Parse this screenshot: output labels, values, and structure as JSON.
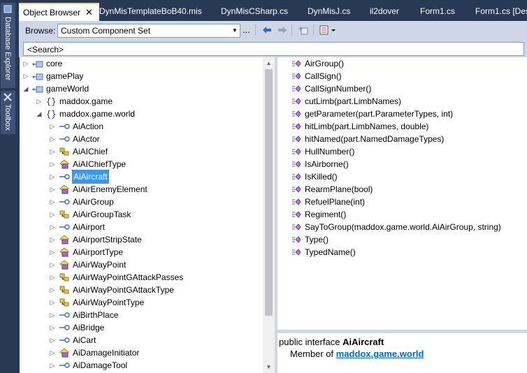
{
  "side_tabs": [
    "Database Explorer",
    "Toolbox"
  ],
  "doc_tabs": [
    {
      "label": "Object Browser",
      "active": true
    },
    {
      "label": "DynMisTemplateBoB40.mis"
    },
    {
      "label": "DynMisCSharp.cs"
    },
    {
      "label": "DynMisJ.cs"
    },
    {
      "label": "il2dover"
    },
    {
      "label": "Form1.cs"
    },
    {
      "label": "Form1.cs [Des"
    }
  ],
  "tab_close": "✕",
  "toolbar": {
    "browse_label": "Browse:",
    "browse_value": "Custom Component Set",
    "ellipsis": "..."
  },
  "search": {
    "placeholder": "<Search>"
  },
  "tree": [
    {
      "label": "core",
      "level": 0,
      "exp": "▷",
      "icon": "namespace-folder-icon"
    },
    {
      "label": "gamePlay",
      "level": 0,
      "exp": "▷",
      "icon": "namespace-folder-icon"
    },
    {
      "label": "gameWorld",
      "level": 0,
      "exp": "◢",
      "icon": "namespace-folder-icon"
    },
    {
      "label": "maddox.game",
      "level": 1,
      "exp": "▷",
      "icon": "namespace-braces-icon"
    },
    {
      "label": "maddox.game.world",
      "level": 1,
      "exp": "◢",
      "icon": "namespace-braces-icon"
    },
    {
      "label": "AiAction",
      "level": 2,
      "exp": "▷",
      "icon": "interface-icon"
    },
    {
      "label": "AiActor",
      "level": 2,
      "exp": "▷",
      "icon": "interface-icon"
    },
    {
      "label": "AiAIChief",
      "level": 2,
      "exp": "▷",
      "icon": "class-icon"
    },
    {
      "label": "AiAIChiefType",
      "level": 2,
      "exp": "▷",
      "icon": "enum-icon"
    },
    {
      "label": "AiAircraft",
      "level": 2,
      "exp": "▷",
      "icon": "interface-icon",
      "selected": true
    },
    {
      "label": "AiAirEnemyElement",
      "level": 2,
      "exp": "▷",
      "icon": "enum-icon"
    },
    {
      "label": "AiAirGroup",
      "level": 2,
      "exp": "▷",
      "icon": "interface-icon"
    },
    {
      "label": "AiAirGroupTask",
      "level": 2,
      "exp": "▷",
      "icon": "class-icon"
    },
    {
      "label": "AiAirport",
      "level": 2,
      "exp": "▷",
      "icon": "interface-icon"
    },
    {
      "label": "AiAirportStripState",
      "level": 2,
      "exp": "▷",
      "icon": "enum-icon"
    },
    {
      "label": "AiAirportType",
      "level": 2,
      "exp": "▷",
      "icon": "enum-icon"
    },
    {
      "label": "AiAirWayPoint",
      "level": 2,
      "exp": "▷",
      "icon": "enum-icon"
    },
    {
      "label": "AiAirWayPointGAttackPasses",
      "level": 2,
      "exp": "▷",
      "icon": "class-icon"
    },
    {
      "label": "AiAirWayPointGAttackType",
      "level": 2,
      "exp": "▷",
      "icon": "class-icon"
    },
    {
      "label": "AiAirWayPointType",
      "level": 2,
      "exp": "▷",
      "icon": "class-icon"
    },
    {
      "label": "AiBirthPlace",
      "level": 2,
      "exp": "▷",
      "icon": "interface-icon"
    },
    {
      "label": "AiBridge",
      "level": 2,
      "exp": "▷",
      "icon": "interface-icon"
    },
    {
      "label": "AiCart",
      "level": 2,
      "exp": "▷",
      "icon": "interface-icon"
    },
    {
      "label": "AiDamageInitiator",
      "level": 2,
      "exp": "▷",
      "icon": "enum-icon"
    },
    {
      "label": "AiDamageTool",
      "level": 2,
      "exp": "▷",
      "icon": "interface-icon"
    }
  ],
  "members": [
    "AirGroup()",
    "CallSign()",
    "CallSignNumber()",
    "cutLimb(part.LimbNames)",
    "getParameter(part.ParameterTypes, int)",
    "hitLimb(part.LimbNames, double)",
    "hitNamed(part.NamedDamageTypes)",
    "HullNumber()",
    "IsAirborne()",
    "IsKilled()",
    "RearmPlane(bool)",
    "RefuelPlane(int)",
    "Regiment()",
    "SayToGroup(maddox.game.world.AiAirGroup, string)",
    "Type()",
    "TypedName()"
  ],
  "description": {
    "prefix": "public interface ",
    "name": "AiAircraft",
    "member_of": "Member of ",
    "namespace": "maddox.game.world"
  }
}
